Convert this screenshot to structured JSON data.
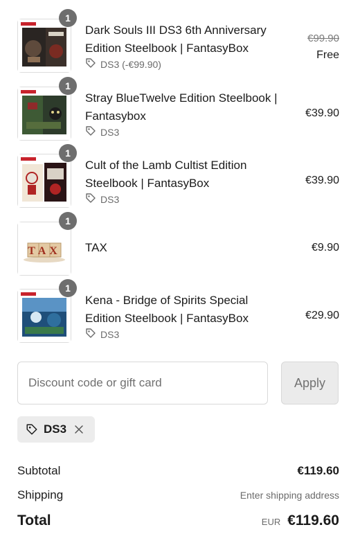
{
  "items": [
    {
      "qty": "1",
      "title": "Dark Souls III DS3 6th Anniversary Edition Steelbook | FantasyBox",
      "discount": "DS3 (-€99.90)",
      "original_price": "€99.90",
      "price": "Free",
      "image": "steelbook-dark-souls"
    },
    {
      "qty": "1",
      "title": "Stray BlueTwelve Edition Steelbook | Fantasybox",
      "discount": "DS3",
      "price": "€39.90",
      "image": "steelbook-stray"
    },
    {
      "qty": "1",
      "title": "Cult of the Lamb Cultist Edition Steelbook | FantasyBox",
      "discount": "DS3",
      "price": "€39.90",
      "image": "steelbook-cult-of-the-lamb"
    },
    {
      "qty": "1",
      "title": "TAX",
      "price": "€9.90",
      "image": "tax-blocks",
      "image_text": "TAX"
    },
    {
      "qty": "1",
      "title": "Kena - Bridge of Spirits Special Edition Steelbook | FantasyBox",
      "discount": "DS3",
      "price": "€29.90",
      "image": "steelbook-kena"
    }
  ],
  "discount_form": {
    "placeholder": "Discount code or gift card",
    "value": "",
    "apply_label": "Apply"
  },
  "applied_code": {
    "code": "DS3"
  },
  "summary": {
    "subtotal_label": "Subtotal",
    "subtotal_value": "€119.60",
    "shipping_label": "Shipping",
    "shipping_value": "Enter shipping address",
    "total_label": "Total",
    "currency": "EUR",
    "total_value": "€119.60"
  },
  "colors": {
    "badge": "#6e6e6e",
    "chip_bg": "#ececec",
    "apply_bg": "#ebebeb",
    "muted_text": "#6b6b6b"
  }
}
